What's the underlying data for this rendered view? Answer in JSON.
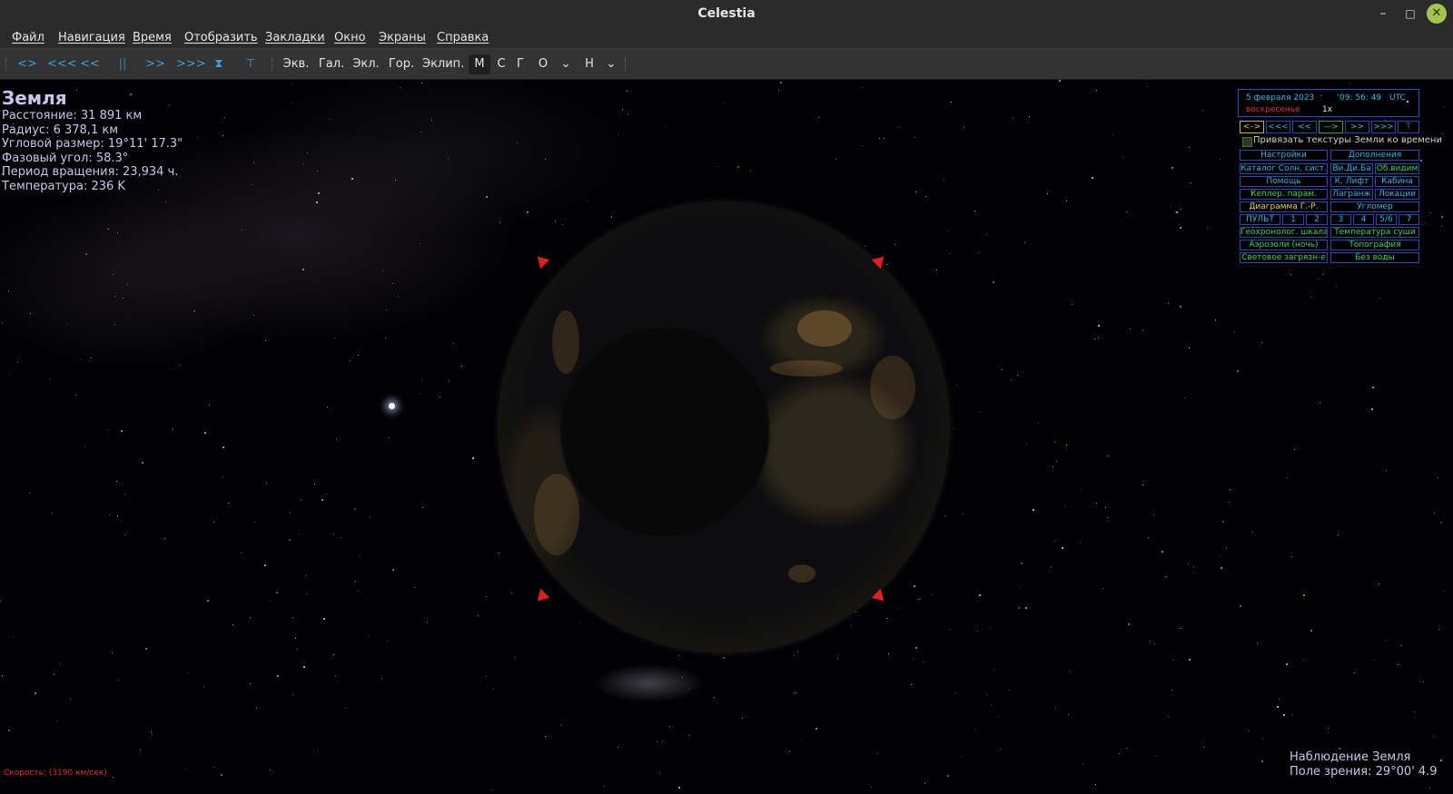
{
  "window": {
    "title": "Celestia",
    "min_glyph": "–",
    "max_glyph": "□",
    "close_glyph": "✕"
  },
  "menu": [
    "Файл",
    "Навигация",
    "Время",
    "Отобразить",
    "Закладки",
    "Окно",
    "Экраны",
    "Справка"
  ],
  "toolbar": {
    "time_icons": [
      "<>",
      "<<<",
      "<<",
      "||",
      ">>",
      ">>>",
      "⧗",
      "⊤"
    ],
    "frame_buttons": [
      "Экв.",
      "Гал.",
      "Экл.",
      "Гор.",
      "Эклип."
    ],
    "view_buttons": [
      "М",
      "С",
      "Г",
      "О",
      "Н"
    ],
    "dropdown_glyph": "⌄",
    "selected": "М"
  },
  "object_info": {
    "name": "Земля",
    "distance": "Расстояние: 31 891 км",
    "radius": "Радиус: 6 378,1 км",
    "angular_size": "Угловой размер: 19°11' 17.3\"",
    "phase_angle": "Фазовый угол: 58.3°",
    "rotation_period": "Период вращения: 23,934 ч.",
    "temperature": "Температура: 236 K"
  },
  "speed_text": "Скорость: (3190 км/сек)",
  "status": {
    "observing": "Наблюдение Земля",
    "fov": "Поле зрения: 29°00' 4.9"
  },
  "lua_panel": {
    "date": "5 февраля 2023",
    "time": "09: 56: 49",
    "timezone": "UTC",
    "weekday": "воскресенье",
    "rate": "1x",
    "time_buttons": [
      "<–>",
      "<<<",
      "<<",
      "—>",
      ">>",
      ">>>",
      "⊤"
    ],
    "earth_texture_checkbox": "Привязать текстуры Земли ко времени",
    "rows": [
      [
        "Настройки",
        "Дополнения"
      ],
      [
        "Каталог Солн. сист.",
        "Ви.Ди.Ба",
        "Об.видим"
      ],
      [
        "Помощь",
        "К. Лифт",
        "Кабина"
      ],
      [
        "Кеплер. парам.",
        "Лагранж",
        "Локации"
      ],
      [
        "Диаграмма Г.-Р.",
        "Угломер"
      ],
      [
        "ПУЛЬТ",
        "1",
        "2",
        "3",
        "4",
        "5/6",
        "7"
      ],
      [
        "Геохронолог. шкала",
        "Температура суши"
      ],
      [
        "Аэрозоли (ночь)",
        "Топография"
      ],
      [
        "Световое загрязн-е",
        "Без воды"
      ]
    ]
  },
  "colors": {
    "hud_text": "#c9c6e8",
    "speed_text": "#e03030",
    "panel_border": "#1f4fc7",
    "panel_cyan": "#28b7e6",
    "panel_green": "#38d84a",
    "panel_yellow": "#e6d239",
    "bracket_red": "#e02020",
    "toolbar_icon": "#3aa3d3"
  }
}
